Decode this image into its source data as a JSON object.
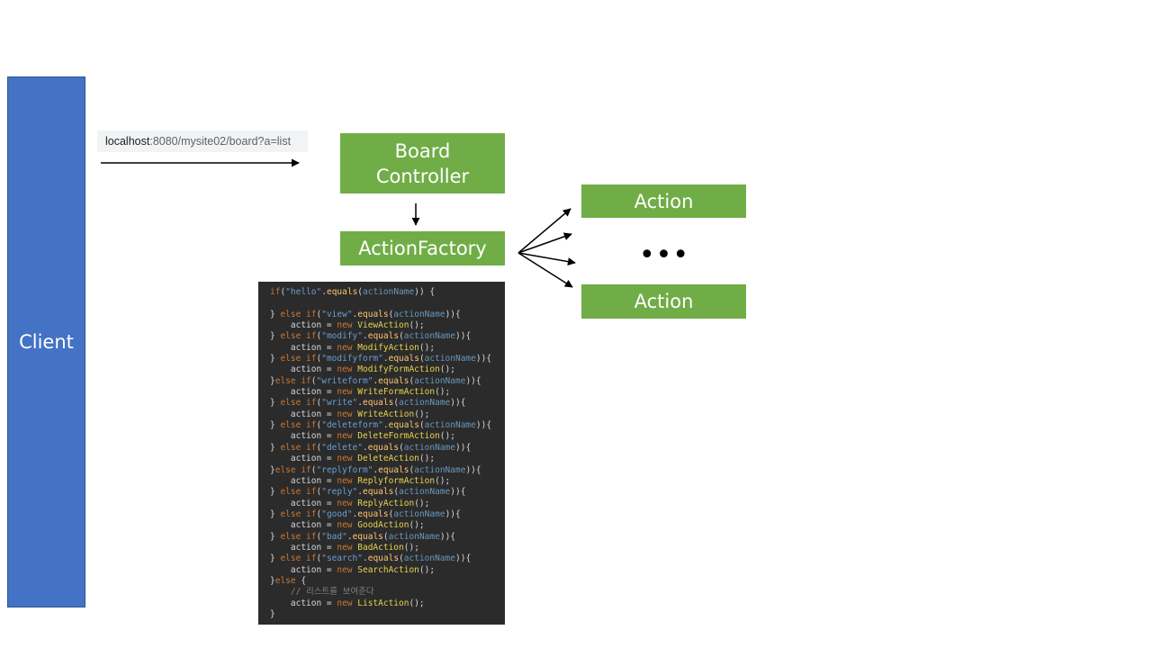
{
  "diagram": {
    "client_label": "Client",
    "url": {
      "host": "localhost",
      "rest": ":8080/mysite02/board?a=list"
    },
    "board_controller_label": "Board\nController",
    "action_factory_label": "ActionFactory",
    "action_top_label": "Action",
    "action_bottom_label": "Action",
    "ellipsis": "•••"
  },
  "colors": {
    "client_fill": "#4472c4",
    "node_fill": "#70ad47",
    "code_background": "#2b2b2b"
  },
  "code_lines": [
    [
      {
        "t": "if",
        "c": "kw"
      },
      {
        "t": "(",
        "c": ""
      },
      {
        "t": "\"hello\"",
        "c": "str"
      },
      {
        "t": ".",
        "c": ""
      },
      {
        "t": "equals",
        "c": "fn"
      },
      {
        "t": "(",
        "c": ""
      },
      {
        "t": "actionName",
        "c": "var"
      },
      {
        "t": ")) {",
        "c": ""
      }
    ],
    [],
    [
      {
        "t": "} ",
        "c": ""
      },
      {
        "t": "else if",
        "c": "kw"
      },
      {
        "t": "(",
        "c": ""
      },
      {
        "t": "\"view\"",
        "c": "str"
      },
      {
        "t": ".",
        "c": ""
      },
      {
        "t": "equals",
        "c": "fn"
      },
      {
        "t": "(",
        "c": ""
      },
      {
        "t": "actionName",
        "c": "var"
      },
      {
        "t": ")){",
        "c": ""
      }
    ],
    [
      {
        "t": "    action = ",
        "c": ""
      },
      {
        "t": "new",
        "c": "kw"
      },
      {
        "t": " ",
        "c": ""
      },
      {
        "t": "ViewAction",
        "c": "cls"
      },
      {
        "t": "();",
        "c": ""
      }
    ],
    [
      {
        "t": "} ",
        "c": ""
      },
      {
        "t": "else if",
        "c": "kw"
      },
      {
        "t": "(",
        "c": ""
      },
      {
        "t": "\"modify\"",
        "c": "str"
      },
      {
        "t": ".",
        "c": ""
      },
      {
        "t": "equals",
        "c": "fn"
      },
      {
        "t": "(",
        "c": ""
      },
      {
        "t": "actionName",
        "c": "var"
      },
      {
        "t": ")){",
        "c": ""
      }
    ],
    [
      {
        "t": "    action = ",
        "c": ""
      },
      {
        "t": "new",
        "c": "kw"
      },
      {
        "t": " ",
        "c": ""
      },
      {
        "t": "ModifyAction",
        "c": "cls"
      },
      {
        "t": "();",
        "c": ""
      }
    ],
    [
      {
        "t": "} ",
        "c": ""
      },
      {
        "t": "else if",
        "c": "kw"
      },
      {
        "t": "(",
        "c": ""
      },
      {
        "t": "\"modifyform\"",
        "c": "str"
      },
      {
        "t": ".",
        "c": ""
      },
      {
        "t": "equals",
        "c": "fn"
      },
      {
        "t": "(",
        "c": ""
      },
      {
        "t": "actionName",
        "c": "var"
      },
      {
        "t": ")){",
        "c": ""
      }
    ],
    [
      {
        "t": "    action = ",
        "c": ""
      },
      {
        "t": "new",
        "c": "kw"
      },
      {
        "t": " ",
        "c": ""
      },
      {
        "t": "ModifyFormAction",
        "c": "cls"
      },
      {
        "t": "();",
        "c": ""
      }
    ],
    [
      {
        "t": "}",
        "c": ""
      },
      {
        "t": "else if",
        "c": "kw"
      },
      {
        "t": "(",
        "c": ""
      },
      {
        "t": "\"writeform\"",
        "c": "str"
      },
      {
        "t": ".",
        "c": ""
      },
      {
        "t": "equals",
        "c": "fn"
      },
      {
        "t": "(",
        "c": ""
      },
      {
        "t": "actionName",
        "c": "var"
      },
      {
        "t": ")){",
        "c": ""
      }
    ],
    [
      {
        "t": "    action = ",
        "c": ""
      },
      {
        "t": "new",
        "c": "kw"
      },
      {
        "t": " ",
        "c": ""
      },
      {
        "t": "WriteFormAction",
        "c": "cls"
      },
      {
        "t": "();",
        "c": ""
      }
    ],
    [
      {
        "t": "} ",
        "c": ""
      },
      {
        "t": "else if",
        "c": "kw"
      },
      {
        "t": "(",
        "c": ""
      },
      {
        "t": "\"write\"",
        "c": "str"
      },
      {
        "t": ".",
        "c": ""
      },
      {
        "t": "equals",
        "c": "fn"
      },
      {
        "t": "(",
        "c": ""
      },
      {
        "t": "actionName",
        "c": "var"
      },
      {
        "t": ")){",
        "c": ""
      }
    ],
    [
      {
        "t": "    action = ",
        "c": ""
      },
      {
        "t": "new",
        "c": "kw"
      },
      {
        "t": " ",
        "c": ""
      },
      {
        "t": "WriteAction",
        "c": "cls"
      },
      {
        "t": "();",
        "c": ""
      }
    ],
    [
      {
        "t": "} ",
        "c": ""
      },
      {
        "t": "else if",
        "c": "kw"
      },
      {
        "t": "(",
        "c": ""
      },
      {
        "t": "\"deleteform\"",
        "c": "str"
      },
      {
        "t": ".",
        "c": ""
      },
      {
        "t": "equals",
        "c": "fn"
      },
      {
        "t": "(",
        "c": ""
      },
      {
        "t": "actionName",
        "c": "var"
      },
      {
        "t": ")){",
        "c": ""
      }
    ],
    [
      {
        "t": "    action = ",
        "c": ""
      },
      {
        "t": "new",
        "c": "kw"
      },
      {
        "t": " ",
        "c": ""
      },
      {
        "t": "DeleteFormAction",
        "c": "cls"
      },
      {
        "t": "();",
        "c": ""
      }
    ],
    [
      {
        "t": "} ",
        "c": ""
      },
      {
        "t": "else if",
        "c": "kw"
      },
      {
        "t": "(",
        "c": ""
      },
      {
        "t": "\"delete\"",
        "c": "str"
      },
      {
        "t": ".",
        "c": ""
      },
      {
        "t": "equals",
        "c": "fn"
      },
      {
        "t": "(",
        "c": ""
      },
      {
        "t": "actionName",
        "c": "var"
      },
      {
        "t": ")){",
        "c": ""
      }
    ],
    [
      {
        "t": "    action = ",
        "c": ""
      },
      {
        "t": "new",
        "c": "kw"
      },
      {
        "t": " ",
        "c": ""
      },
      {
        "t": "DeleteAction",
        "c": "cls"
      },
      {
        "t": "();",
        "c": ""
      }
    ],
    [
      {
        "t": "}",
        "c": ""
      },
      {
        "t": "else if",
        "c": "kw"
      },
      {
        "t": "(",
        "c": ""
      },
      {
        "t": "\"replyform\"",
        "c": "str"
      },
      {
        "t": ".",
        "c": ""
      },
      {
        "t": "equals",
        "c": "fn"
      },
      {
        "t": "(",
        "c": ""
      },
      {
        "t": "actionName",
        "c": "var"
      },
      {
        "t": ")){",
        "c": ""
      }
    ],
    [
      {
        "t": "    action = ",
        "c": ""
      },
      {
        "t": "new",
        "c": "kw"
      },
      {
        "t": " ",
        "c": ""
      },
      {
        "t": "ReplyformAction",
        "c": "cls"
      },
      {
        "t": "();",
        "c": ""
      }
    ],
    [
      {
        "t": "} ",
        "c": ""
      },
      {
        "t": "else if",
        "c": "kw"
      },
      {
        "t": "(",
        "c": ""
      },
      {
        "t": "\"reply\"",
        "c": "str"
      },
      {
        "t": ".",
        "c": ""
      },
      {
        "t": "equals",
        "c": "fn"
      },
      {
        "t": "(",
        "c": ""
      },
      {
        "t": "actionName",
        "c": "var"
      },
      {
        "t": ")){",
        "c": ""
      }
    ],
    [
      {
        "t": "    action = ",
        "c": ""
      },
      {
        "t": "new",
        "c": "kw"
      },
      {
        "t": " ",
        "c": ""
      },
      {
        "t": "ReplyAction",
        "c": "cls"
      },
      {
        "t": "();",
        "c": ""
      }
    ],
    [
      {
        "t": "} ",
        "c": ""
      },
      {
        "t": "else if",
        "c": "kw"
      },
      {
        "t": "(",
        "c": ""
      },
      {
        "t": "\"good\"",
        "c": "str"
      },
      {
        "t": ".",
        "c": ""
      },
      {
        "t": "equals",
        "c": "fn"
      },
      {
        "t": "(",
        "c": ""
      },
      {
        "t": "actionName",
        "c": "var"
      },
      {
        "t": ")){",
        "c": ""
      }
    ],
    [
      {
        "t": "    action = ",
        "c": ""
      },
      {
        "t": "new",
        "c": "kw"
      },
      {
        "t": " ",
        "c": ""
      },
      {
        "t": "GoodAction",
        "c": "cls"
      },
      {
        "t": "();",
        "c": ""
      }
    ],
    [
      {
        "t": "} ",
        "c": ""
      },
      {
        "t": "else if",
        "c": "kw"
      },
      {
        "t": "(",
        "c": ""
      },
      {
        "t": "\"bad\"",
        "c": "str"
      },
      {
        "t": ".",
        "c": ""
      },
      {
        "t": "equals",
        "c": "fn"
      },
      {
        "t": "(",
        "c": ""
      },
      {
        "t": "actionName",
        "c": "var"
      },
      {
        "t": ")){",
        "c": ""
      }
    ],
    [
      {
        "t": "    action = ",
        "c": ""
      },
      {
        "t": "new",
        "c": "kw"
      },
      {
        "t": " ",
        "c": ""
      },
      {
        "t": "BadAction",
        "c": "cls"
      },
      {
        "t": "();",
        "c": ""
      }
    ],
    [
      {
        "t": "} ",
        "c": ""
      },
      {
        "t": "else if",
        "c": "kw"
      },
      {
        "t": "(",
        "c": ""
      },
      {
        "t": "\"search\"",
        "c": "str"
      },
      {
        "t": ".",
        "c": ""
      },
      {
        "t": "equals",
        "c": "fn"
      },
      {
        "t": "(",
        "c": ""
      },
      {
        "t": "actionName",
        "c": "var"
      },
      {
        "t": ")){",
        "c": ""
      }
    ],
    [
      {
        "t": "    action = ",
        "c": ""
      },
      {
        "t": "new",
        "c": "kw"
      },
      {
        "t": " ",
        "c": ""
      },
      {
        "t": "SearchAction",
        "c": "cls"
      },
      {
        "t": "();",
        "c": ""
      }
    ],
    [
      {
        "t": "}",
        "c": ""
      },
      {
        "t": "else",
        "c": "kw"
      },
      {
        "t": " {",
        "c": ""
      }
    ],
    [
      {
        "t": "    // 리스트를 보여준다",
        "c": "cm"
      }
    ],
    [
      {
        "t": "    action = ",
        "c": ""
      },
      {
        "t": "new",
        "c": "kw"
      },
      {
        "t": " ",
        "c": ""
      },
      {
        "t": "ListAction",
        "c": "cls"
      },
      {
        "t": "();",
        "c": ""
      }
    ],
    [
      {
        "t": "}",
        "c": ""
      }
    ]
  ]
}
